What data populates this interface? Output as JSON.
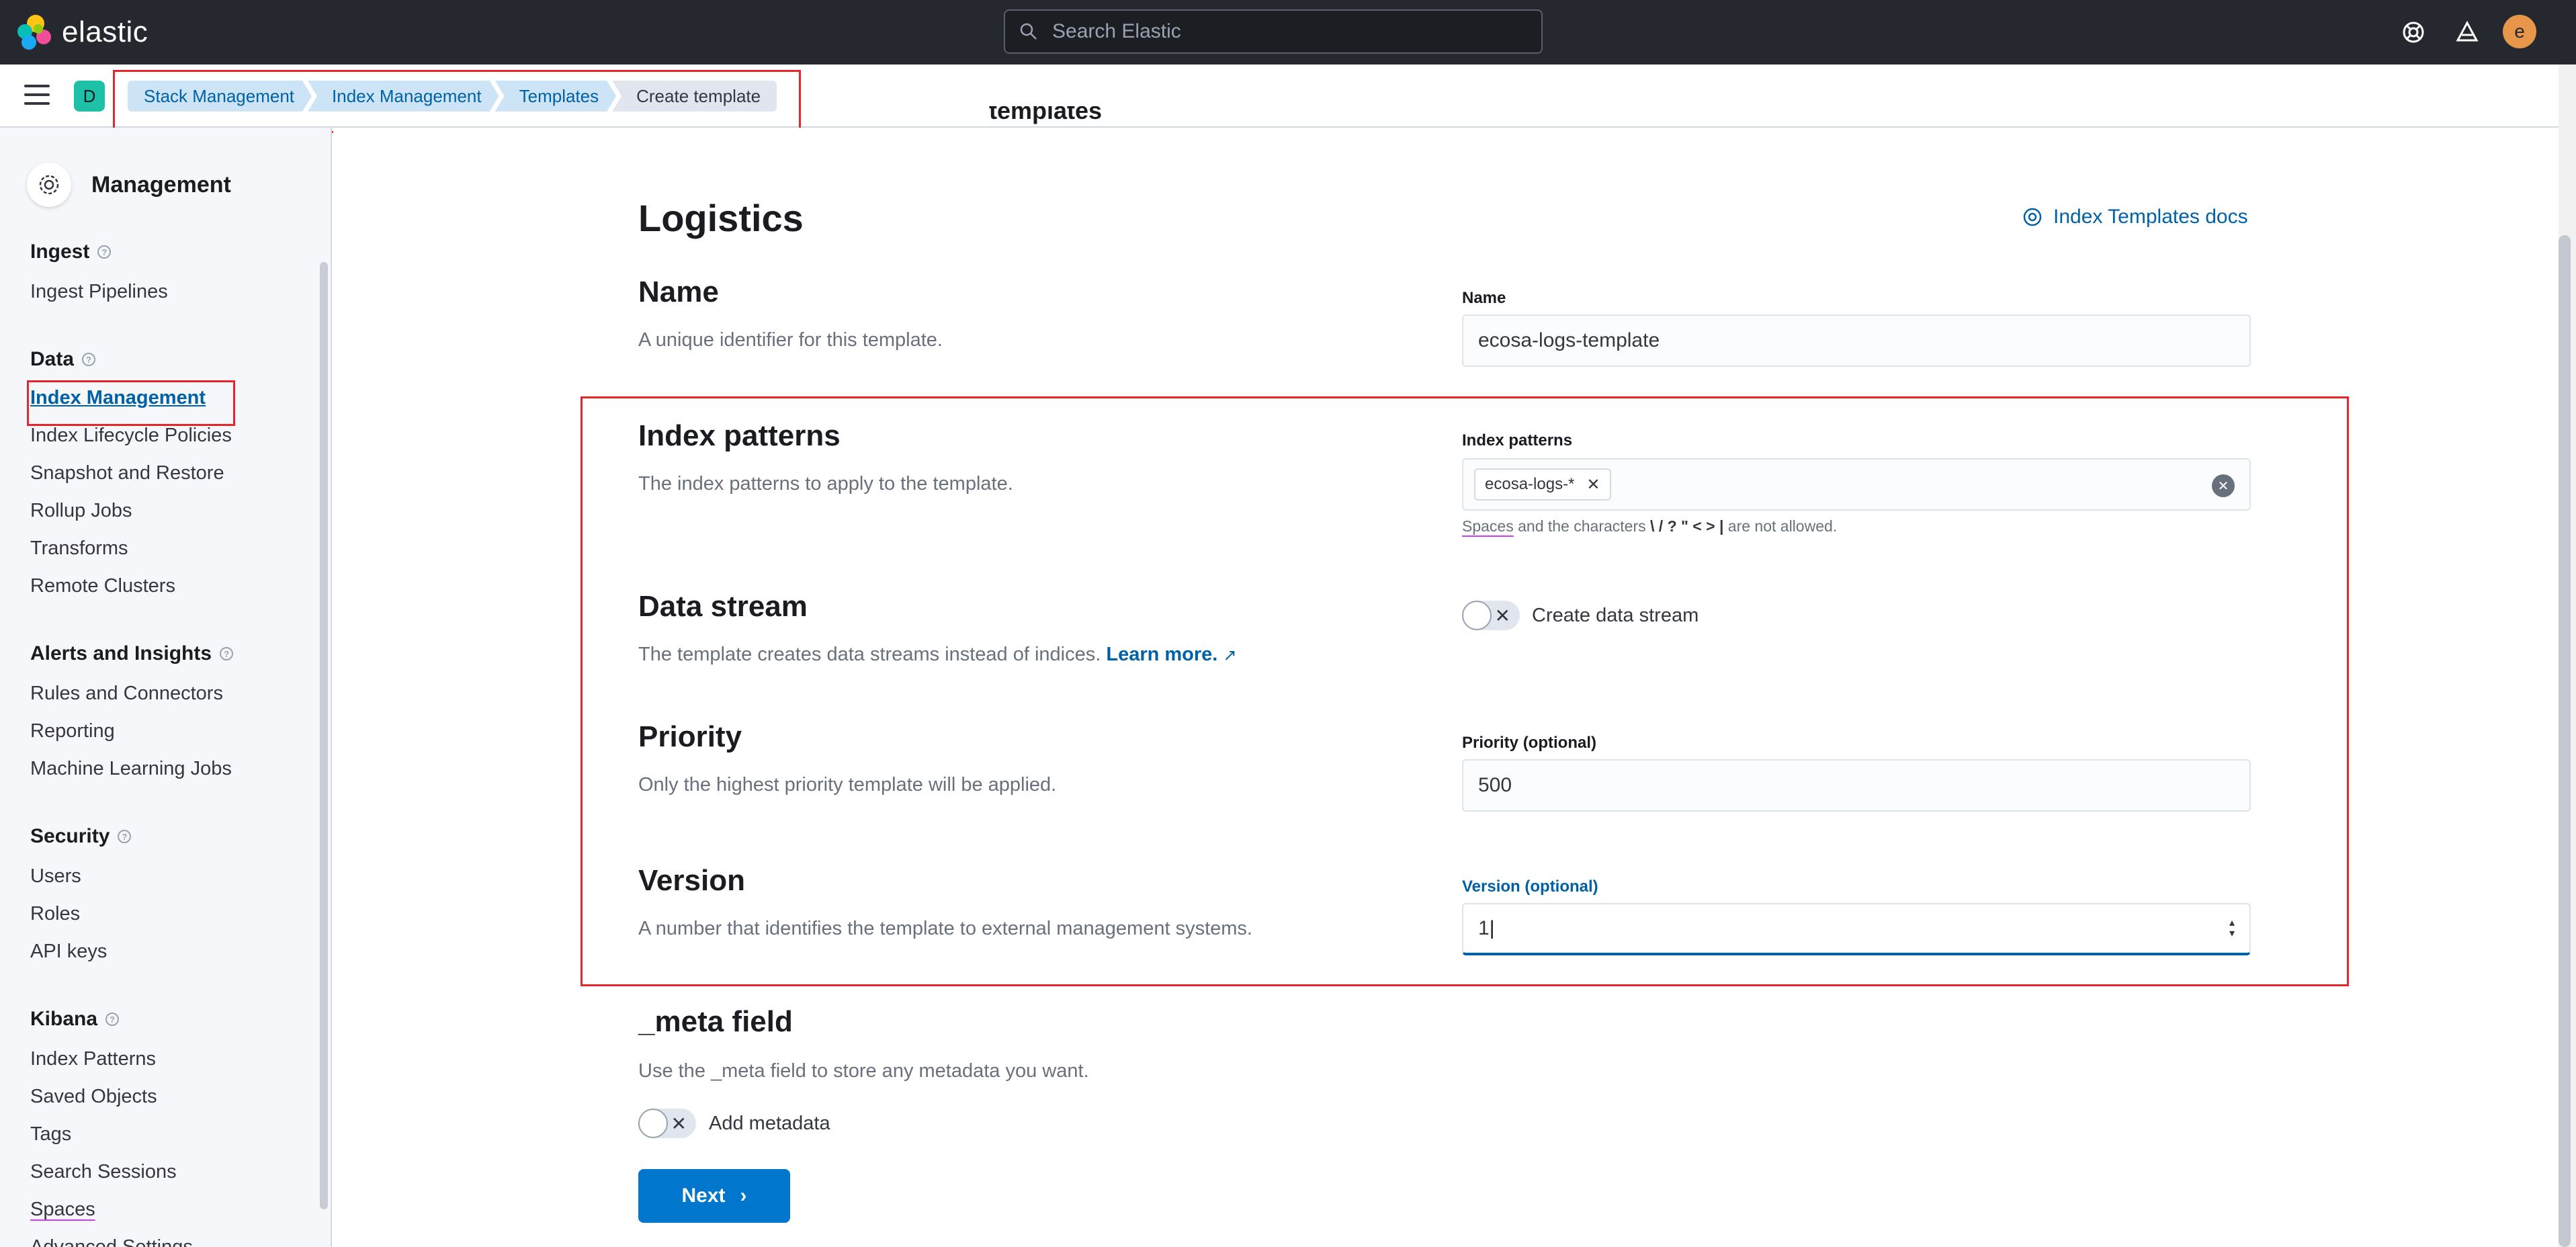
{
  "header": {
    "brand": "elastic",
    "search_placeholder": "Search Elastic",
    "user_initial": "e",
    "colors": {
      "bg": "#25282f",
      "avatar": "#e7964a"
    }
  },
  "breadcrumbs": {
    "space_initial": "D",
    "items": [
      "Stack Management",
      "Index Management",
      "Templates",
      "Create template"
    ]
  },
  "sidebar": {
    "title": "Management",
    "groups": [
      {
        "label": "Ingest",
        "items": [
          "Ingest Pipelines"
        ]
      },
      {
        "label": "Data",
        "items": [
          "Index Management",
          "Index Lifecycle Policies",
          "Snapshot and Restore",
          "Rollup Jobs",
          "Transforms",
          "Remote Clusters"
        ]
      },
      {
        "label": "Alerts and Insights",
        "items": [
          "Rules and Connectors",
          "Reporting",
          "Machine Learning Jobs"
        ]
      },
      {
        "label": "Security",
        "items": [
          "Users",
          "Roles",
          "API keys"
        ]
      },
      {
        "label": "Kibana",
        "items": [
          "Index Patterns",
          "Saved Objects",
          "Tags",
          "Search Sessions",
          "Spaces",
          "Advanced Settings"
        ]
      }
    ],
    "active_item": "Index Management"
  },
  "main": {
    "cut_heading": "templates",
    "title": "Logistics",
    "docs_link": "Index Templates docs",
    "name": {
      "title": "Name",
      "desc": "A unique identifier for this template.",
      "label": "Name",
      "value": "ecosa-logs-template"
    },
    "index_patterns": {
      "title": "Index patterns",
      "desc": "The index patterns to apply to the template.",
      "label": "Index patterns",
      "chip": "ecosa-logs-*",
      "help_prefix": "Spaces",
      "help_mid": " and the characters ",
      "help_chars": "\\ / ? \" < > |",
      "help_suffix": " are not allowed."
    },
    "data_stream": {
      "title": "Data stream",
      "desc": "The template creates data streams instead of indices.",
      "learn_more": "Learn more.",
      "toggle_label": "Create data stream"
    },
    "priority": {
      "title": "Priority",
      "desc": "Only the highest priority template will be applied.",
      "label": "Priority (optional)",
      "value": "500"
    },
    "version": {
      "title": "Version",
      "desc": "A number that identifies the template to external management systems.",
      "label": "Version (optional)",
      "value": "1"
    },
    "meta": {
      "title": "_meta field",
      "desc": "Use the _meta field to store any metadata you want.",
      "toggle_label": "Add metadata"
    },
    "next_label": "Next",
    "colors": {
      "primary": "#0077cc",
      "link": "#0061a6",
      "highlight_box": "#e7262b"
    }
  }
}
